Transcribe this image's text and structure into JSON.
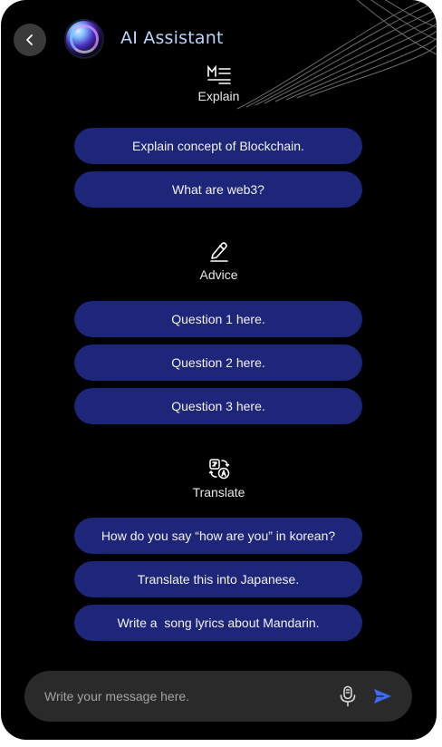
{
  "header": {
    "title": "AI Assistant",
    "back_icon": "chevron-left-icon",
    "avatar_icon": "ai-orb-avatar"
  },
  "sections": [
    {
      "icon": "markdown-text-icon",
      "label": "Explain",
      "questions": [
        "Explain concept of Blockchain.",
        "What are web3?"
      ]
    },
    {
      "icon": "pencil-icon",
      "label": "Advice",
      "questions": [
        "Question 1 here.",
        "Question 2 here.",
        "Question 3 here."
      ]
    },
    {
      "icon": "translate-icon",
      "label": "Translate",
      "questions": [
        "How do you say “how are you” in korean?",
        "Translate this into Japanese.",
        "Write a  song lyrics about Mandarin."
      ]
    }
  ],
  "composer": {
    "placeholder": "Write your message here.",
    "mic_icon": "microphone-icon",
    "send_icon": "send-icon"
  },
  "colors": {
    "background": "#000000",
    "pill": "#1d2678",
    "title": "#b9d4ff",
    "send": "#3b6cff"
  }
}
